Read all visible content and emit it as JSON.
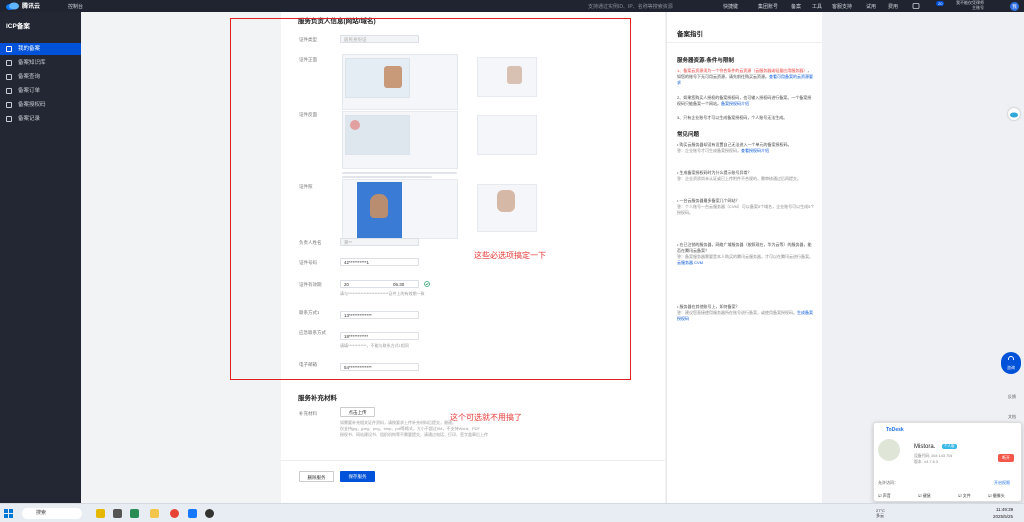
{
  "topbar": {
    "brand": "腾讯云",
    "console": "控制台",
    "search_placeholder": "支持通过实例ID、IP、名称等搜索资源",
    "nav": [
      "快捷键",
      "集团账号",
      "备案",
      "工具",
      "客服支持",
      "试用",
      "费用"
    ],
    "account": "我不能仅凭律师\n主账号",
    "avatar": "我",
    "badge": "20"
  },
  "sidebar": {
    "title": "ICP备案",
    "items": [
      {
        "label": "我的备案",
        "active": true
      },
      {
        "label": "备案知识库",
        "active": false
      },
      {
        "label": "备案查询",
        "active": false
      },
      {
        "label": "备案订单",
        "active": false
      },
      {
        "label": "备案授权码",
        "active": false
      },
      {
        "label": "备案记录",
        "active": false
      }
    ]
  },
  "form": {
    "section_title": "服务负责人信息(网站/域名)",
    "cert_type_label": "证件类型",
    "cert_type_value": "居民身份证",
    "id_front_label": "证件正面",
    "id_back_label": "证件反面",
    "photo_label": "证件照",
    "person_label": "负责人姓名",
    "person_value": "黄**",
    "cert_no_label": "证件号码",
    "cert_no_value": "42**********1",
    "validity_label": "证件有效期",
    "validity_start": "20",
    "validity_end": "06.30",
    "validity_hint": "请与**************************证件上的有效期一致",
    "phone1_label": "联系方式1",
    "phone1_value": "13*************",
    "emergency_label": "应急联系方式",
    "emergency_value": "18***********",
    "emergency_hint": "请填************，不能与联系方式1相同",
    "email_label": "电子邮箱",
    "email_value": "54*************"
  },
  "supplement": {
    "section_title": "服务补充材料",
    "material_label": "补充材料",
    "upload_button": "点击上传",
    "hint1": "如需要补充相关证件资料，请按要求上传补充材料后提交，谢谢。",
    "hint2": "仅支持jpg、jpeg、png、bmp、pdf等格式，大小不超过5M，不支持Word、PDF",
    "hint3": "授权书、网站建设书、组织机构等不需要提交，请通过电话、打印、签字盖章后上传"
  },
  "buttons": {
    "delete": "删除服务",
    "save": "保存服务"
  },
  "annotations": {
    "required": "这些必选项搞定一下",
    "optional": "这个可选就不用搞了"
  },
  "guide": {
    "title": "备案指引",
    "section1": "服务器资源-条件与限制",
    "p1_red": "1、备案云资源须为一个符合条件的云资源（云服务器或轻量应用服务器）",
    "p1_rest": "，如您的账号下无可用云资源，请先前往购买云资源。",
    "p1_link": "查看可用备案的云资源要求",
    "p2": "2、如果您购买人授权的备案授权码，也可输入授权码进行备案。一个备案授权码只能备案一个网站。",
    "p2_link": "备案授权码介绍",
    "p3": "3、只有企业账号才可以生成备案授权码，个人账号无法生成。",
    "section2": "常见问题",
    "faqs": [
      {
        "q": "购买云服务器却没有设置自己无法进入一个单元的备案授权码。",
        "a": "答：企业账号才可生成备案授权码。",
        "link": "查看授权码介绍"
      },
      {
        "q": "生成备案授权码时为什么提示账号异常？",
        "a": "答：企业资质尚未认证或已上传附件不合规的，需审核通过后再提交。"
      },
      {
        "q": "一台云服务器最多备案几个网站？",
        "a": "答：个人账号一台云服务器（CVM）可以备案5个域名，企业账号可以生成5个授权码。"
      },
      {
        "q": "在已注销的服务器，网络广域服务器（按照现在，华为云等）的服务器，能否在腾讯云备案？",
        "a": "答：备案服务器需要是本人购买的腾讯云服务器，才可以在腾讯云进行备案。",
        "link": "云服务器 CVM"
      },
      {
        "q": "服务器在其他账号上，如何备案？",
        "a": "答：建议您直接使用服务器所在账号进行备案，或使用备案授权码。",
        "link": "生成备案授权码"
      }
    ]
  },
  "todesk": {
    "title": "ToDesk",
    "name": "Mistora.",
    "tag": "个人版",
    "device_code": "设备代码: 264 143 704",
    "version": "版本: V4.7.6.3",
    "open_btn": "断开",
    "access_label": "允许访问：",
    "access_link": "开启权限",
    "options": [
      "声音",
      "键鼠",
      "文件",
      "摄像头"
    ]
  },
  "fabs": {
    "chat": "咨询",
    "doc": "文档",
    "share": "反馈"
  },
  "taskbar": {
    "search": "搜索",
    "weather": "27°C\n多云",
    "time": "11:49:39",
    "date": "2025/5/25"
  }
}
